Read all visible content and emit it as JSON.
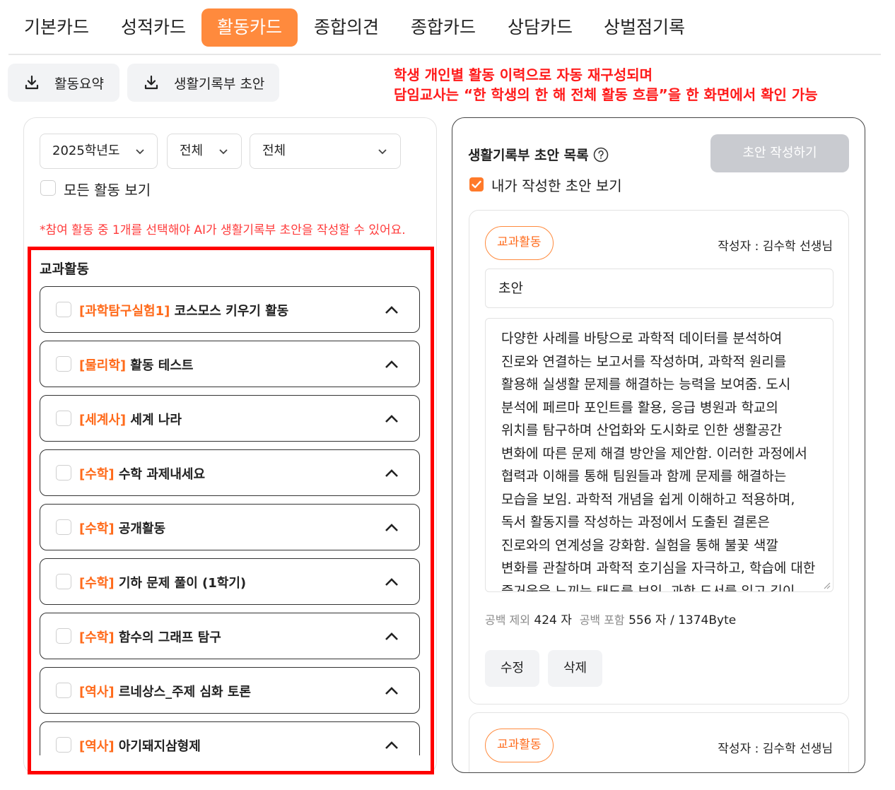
{
  "tabs": [
    {
      "label": "기본카드"
    },
    {
      "label": "성적카드"
    },
    {
      "label": "활동카드"
    },
    {
      "label": "종합의견"
    },
    {
      "label": "종합카드"
    },
    {
      "label": "상담카드"
    },
    {
      "label": "상벌점기록"
    }
  ],
  "active_tab": "활동카드",
  "accent_color": "#ff8a3d",
  "toolbar": {
    "activity_summary_label": "활동요약",
    "record_draft_label": "생활기록부 초안"
  },
  "notice": {
    "line1": "학생 개인별 활동 이력으로 자동 재구성되며",
    "line2": "담임교사는 “한 학생의 한 해 전체 활동 흐름”을 한 화면에서 확인 가능"
  },
  "filters": {
    "year": "2025학년도",
    "filter2": "전체",
    "filter3": "전체",
    "show_all_label": "모든 활동 보기",
    "show_all_checked": false
  },
  "hint": "*참여 활동 중 1개를 선택해야 AI가 생활기록부 초안을 작성할 수 있어요.",
  "activities_section": {
    "title": "교과활동",
    "items": [
      {
        "subject": "[과학탐구실험1]",
        "title": "코스모스 키우기 활동"
      },
      {
        "subject": "[물리학]",
        "title": "활동 테스트"
      },
      {
        "subject": "[세계사]",
        "title": "세계 나라"
      },
      {
        "subject": "[수학]",
        "title": "수학 과제내세요"
      },
      {
        "subject": "[수학]",
        "title": "공개활동"
      },
      {
        "subject": "[수학]",
        "title": "기하 문제 풀이 (1학기)"
      },
      {
        "subject": "[수학]",
        "title": "함수의 그래프 탐구"
      },
      {
        "subject": "[역사]",
        "title": "르네상스_주제 심화 토론"
      },
      {
        "subject": "[역사]",
        "title": "아기돼지삼형제"
      }
    ]
  },
  "drafts_panel": {
    "title": "생활기록부 초안 목록",
    "write_button": "초안 작성하기",
    "mine_only_label": "내가 작성한 초안 보기",
    "mine_only_checked": true,
    "cards": [
      {
        "badge": "교과활동",
        "author": "작성자 : 김수학 선생님",
        "field_label": "초안",
        "body": "다양한 사례를 바탕으로 과학적 데이터를 분석하여 진로와 연결하는 보고서를 작성하며, 과학적 원리를 활용해 실생활 문제를 해결하는 능력을 보여줌. 도시 분석에 페르마 포인트를 활용, 응급 병원과 학교의 위치를 탐구하며 산업화와 도시화로 인한 생활공간 변화에 따른 문제 해결 방안을 제안함. 이러한 과정에서 협력과 이해를 통해 팀원들과 함께 문제를 해결하는 모습을 보임. 과학적 개념을 쉽게 이해하고 적용하며, 독서 활동지를 작성하는 과정에서 도출된 결론은 진로와의 연계성을 강화함. 실험을 통해 불꽃 색깔 변화를 관찰하며 과학적 호기심을 자극하고, 학습에 대한 즐거움을 느끼는 태도를 보임. 과학 도서를 읽고 깊이 있는",
        "count_excl_label": "공백 제외",
        "count_excl": "424 자",
        "count_incl_label": "공백 포함",
        "count_incl": "556 자 / 1374Byte",
        "edit_button": "수정",
        "delete_button": "삭제"
      },
      {
        "badge": "교과활동",
        "author": "작성자 : 김수학 선생님"
      }
    ]
  }
}
